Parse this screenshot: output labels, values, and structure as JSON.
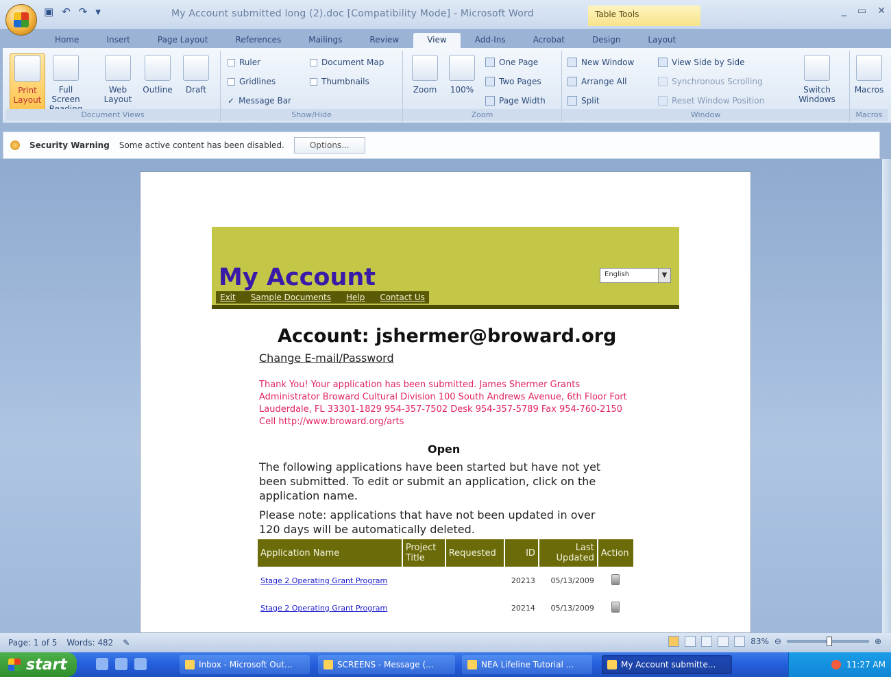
{
  "window": {
    "title": "My Account submitted long (2).doc [Compatibility Mode] - Microsoft Word",
    "context_tab": "Table Tools",
    "controls": [
      "_",
      "▭",
      "✕"
    ]
  },
  "ribbon_tabs": [
    "Home",
    "Insert",
    "Page Layout",
    "References",
    "Mailings",
    "Review",
    "View",
    "Add-Ins",
    "Acrobat",
    "Design",
    "Layout"
  ],
  "ribbon": {
    "document_views": {
      "label": "Document Views",
      "buttons": [
        "Print Layout",
        "Full Screen Reading",
        "Web Layout",
        "Outline",
        "Draft"
      ]
    },
    "show_hide": {
      "label": "Show/Hide",
      "items": [
        "Ruler",
        "Gridlines",
        "Message Bar",
        "Document Map",
        "Thumbnails"
      ]
    },
    "zoom": {
      "label": "Zoom",
      "zoom_btn": "Zoom",
      "hundred_btn": "100%",
      "items": [
        "One Page",
        "Two Pages",
        "Page Width"
      ]
    },
    "window": {
      "label": "Window",
      "items": [
        "New Window",
        "Arrange All",
        "Split",
        "View Side by Side",
        "Synchronous Scrolling",
        "Reset Window Position"
      ],
      "switch": "Switch Windows"
    },
    "macros": {
      "label": "Macros",
      "btn": "Macros"
    }
  },
  "security": {
    "title": "Security Warning",
    "message": "Some active content has been disabled.",
    "options": "Options..."
  },
  "doc": {
    "header_title": "My Account",
    "language": "English",
    "menu": [
      "Exit",
      "Sample Documents",
      "Help",
      "Contact Us"
    ],
    "account": "Account: jshermer@broward.org",
    "change_link": "Change E-mail/Password",
    "thanks": "Thank You! Your application has been submitted. James Shermer Grants Administrator Broward Cultural Division 100 South Andrews Avenue, 6th Floor Fort Lauderdale, FL 33301-1829 954-357-7502 Desk 954-357-5789 Fax 954-760-2150 Cell http://www.broward.org/arts",
    "open_heading": "Open",
    "para1": "The following applications have been started but have not yet been submitted. To edit or submit an application, click on the application name.",
    "para2": "Please note: applications that have not been updated in over 120 days will be automatically deleted.",
    "table": {
      "headers": [
        "Application Name",
        "Project Title",
        "Requested",
        "ID",
        "Last Updated",
        "Action"
      ],
      "rows": [
        {
          "name": "Stage 2 Operating Grant Program",
          "title": "",
          "requested": "",
          "id": "20213",
          "updated": "05/13/2009"
        },
        {
          "name": "Stage 2 Operating Grant Program",
          "title": "",
          "requested": "",
          "id": "20214",
          "updated": "05/13/2009"
        }
      ]
    }
  },
  "status": {
    "page": "Page: 1 of 5",
    "words": "Words: 482",
    "zoom": "83%"
  },
  "taskbar": {
    "start": "start",
    "tasks": [
      "Inbox - Microsoft Out...",
      "SCREENS - Message (...",
      "NEA Lifeline Tutorial ...",
      "My Account submitte..."
    ],
    "time": "11:27 AM"
  }
}
